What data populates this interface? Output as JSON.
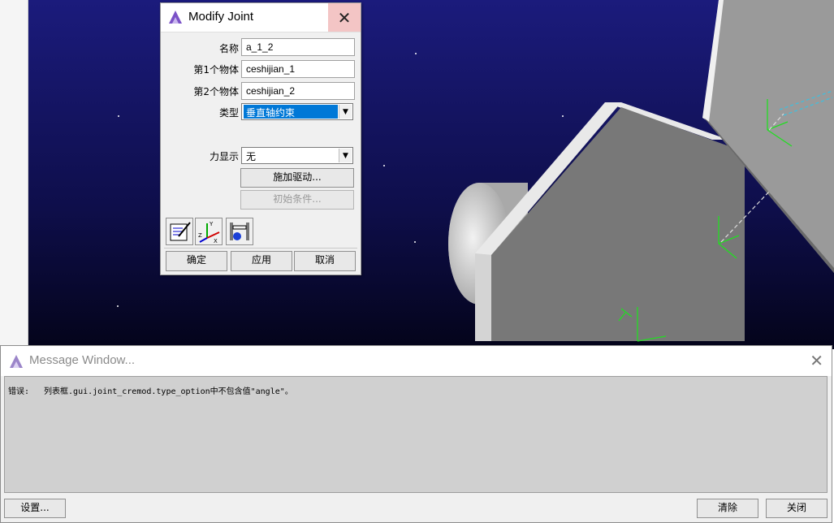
{
  "dialog": {
    "title": "Modify Joint",
    "close_glyph": "✕",
    "name_label": "名称",
    "name_value": "a_1_2",
    "body1_label": "第1个物体",
    "body1_value": "ceshijian_1",
    "body2_label": "第2个物体",
    "body2_value": "ceshijian_2",
    "type_label": "类型",
    "type_value": "垂直轴约束",
    "force_label": "力显示",
    "force_value": "无",
    "apply_drive_label": "施加驱动...",
    "initial_cond_label": "初始条件...",
    "tool_icons": [
      "edit-properties-icon",
      "coordinate-axes-icon",
      "joint-constraint-icon"
    ],
    "ok_label": "确定",
    "apply_label": "应用",
    "cancel_label": "取消"
  },
  "message_window": {
    "title": "Message Window...",
    "close_glyph": "✕",
    "message_tag": "错误:",
    "message_text": "列表框.gui.joint_cremod.type_option中不包含值\"angle\"。",
    "settings_label": "设置...",
    "clear_label": "清除",
    "close_label": "关闭"
  },
  "colors": {
    "scene_top": "#1a1a7a",
    "scene_bottom": "#050518",
    "part_gray": "#7a7a7a",
    "marker_green": "#22dd22",
    "selection_blue": "#0078d7",
    "close_hover": "#f3c5c5"
  }
}
